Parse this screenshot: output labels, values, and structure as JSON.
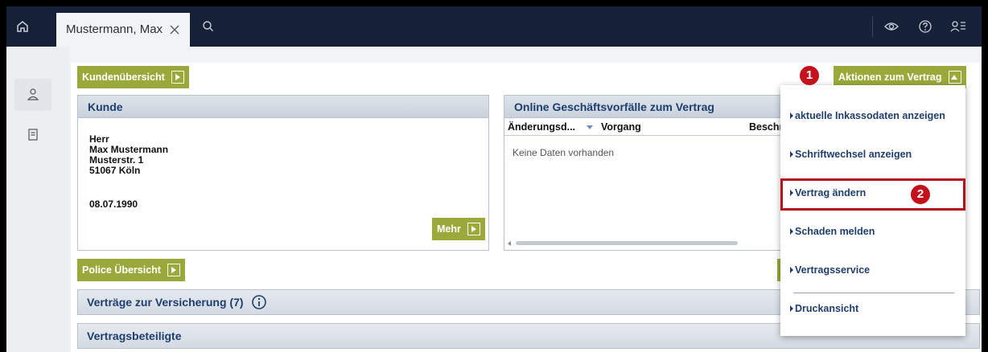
{
  "topbar": {
    "tab_label": "Mustermann, Max",
    "icons": [
      "home-icon",
      "close-icon",
      "search-icon",
      "eye-icon",
      "help-icon",
      "user-settings-icon"
    ],
    "bg_color": "#162036"
  },
  "rail": {
    "icons": [
      "person-icon",
      "document-icon"
    ]
  },
  "buttons": {
    "kundenuebersicht": "Kundenübersicht",
    "aktionen": "Aktionen zum Vertrag",
    "mehr": "Mehr",
    "police": "Police Übersicht",
    "accent_color": "#9aaa3a"
  },
  "kunde": {
    "title": "Kunde",
    "salutation": "Herr",
    "name": "Max Mustermann",
    "street": "Musterstr. 1",
    "city": "51067 Köln",
    "birthdate": "08.07.1990"
  },
  "online": {
    "title": "Online Geschäftsvorfälle zum Vertrag",
    "columns": [
      "Änderungsd...",
      "Vorgang",
      "Beschr"
    ],
    "empty_text": "Keine Daten vorhanden"
  },
  "sections": {
    "vertraege": "Verträge zur Versicherung (7)",
    "beteiligte": "Vertragsbeteiligte"
  },
  "menu": {
    "items": [
      "aktuelle Inkassodaten anzeigen",
      "Schriftwechsel anzeigen",
      "Vertrag ändern",
      "Schaden melden",
      "Vertragsservice",
      "Druckansicht"
    ],
    "highlighted_index": 2
  },
  "callouts": {
    "one": "1",
    "two": "2",
    "color": "#c4121c"
  },
  "partial_text": {
    "a_fragment": "a"
  }
}
